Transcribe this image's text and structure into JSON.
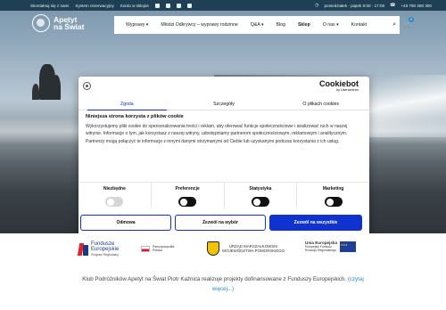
{
  "topbar": {
    "links": [
      "Skontaktuj się z nami",
      "System rezerwacyjny",
      "Konto w sklepie"
    ],
    "hours": "poniedziałek - piątek 9:00 - 17:00",
    "phone": "+48 790 280 300",
    "social_icons": [
      "facebook-icon",
      "youtube-icon",
      "instagram-icon",
      "mail-icon"
    ]
  },
  "logo": {
    "line1": "Apetyt",
    "line2": "na Świat"
  },
  "nav": {
    "items": [
      "Wyprawy ▾",
      "Młodzi Odkrywcy – wyprawy rodzinne",
      "Q&A ▾",
      "Blog",
      "Sklep",
      "O nas ▾",
      "Kontakt"
    ],
    "active_index": 4,
    "cart_count": "0"
  },
  "cookie": {
    "brand": "Cookiebot",
    "brand_sub": "by Usercentrics",
    "tabs": [
      "Zgoda",
      "Szczegóły",
      "O plikach cookies"
    ],
    "active_tab": 0,
    "heading": "Niniejsza strona korzysta z plików cookie",
    "body": "Wykorzystujemy pliki cookie do spersonalizowania treści i reklam, aby oferować funkcje społecznościowe i analizować ruch w naszej witrynie. Informacje o tym, jak korzystasz z naszej witryny, udostępniamy partnerom społecznościowym, reklamowym i analitycznym. Partnerzy mogą połączyć te informacje z innymi danymi otrzymanymi od Ciebie lub uzyskanymi podczas korzystania z ich usług.",
    "toggles": [
      {
        "label": "Niezbędne",
        "state": "disabled"
      },
      {
        "label": "Preferencje",
        "state": "off"
      },
      {
        "label": "Statystyka",
        "state": "off"
      },
      {
        "label": "Marketing",
        "state": "off"
      }
    ],
    "buttons": {
      "deny": "Odmowa",
      "selection": "Zezwól na wybór",
      "accept_all": "Zezwól na wszystkie"
    },
    "accent": "#1032cf"
  },
  "funding": {
    "fe_title1": "Fundusze",
    "fe_title2": "Europejskie",
    "fe_sub": "Program Regionalny",
    "pl_line1": "Rzeczpospolita",
    "pl_line2": "Polska",
    "woj_line1": "URZĄD MARSZAŁKOWSKI",
    "woj_line2": "WOJEWÓDZTWA POMORSKIEGO",
    "ue_title": "Unia Europejska",
    "ue_line1": "Europejski Fundusz",
    "ue_line2": "Rozwoju Regionalnego"
  },
  "footer": {
    "text": "Klub Podróżników Apetyt na Świat Piotr Kaźnica realizuje projekty dofinansowane z Funduszy Europejskich.",
    "link1": "(czytaj",
    "link2": "więcej...)"
  }
}
